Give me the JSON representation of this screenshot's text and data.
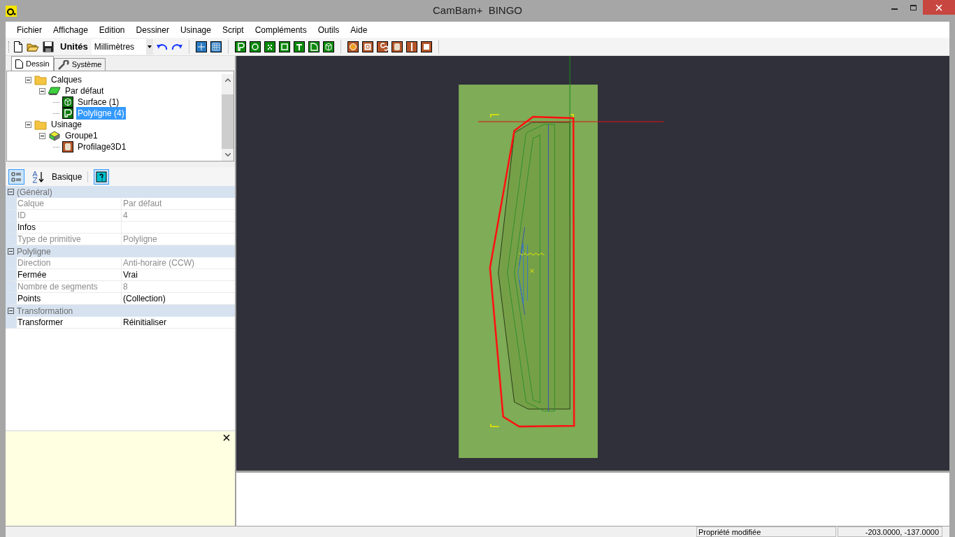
{
  "window": {
    "title": "CamBam+  BINGO"
  },
  "menu": [
    "Fichier",
    "Affichage",
    "Edition",
    "Dessiner",
    "Usinage",
    "Script",
    "Compléments",
    "Outils",
    "Aide"
  ],
  "toolbar": {
    "units_label": "Unités",
    "units_value": "Millimètres"
  },
  "tabs": [
    {
      "label": "Dessin",
      "selected": true
    },
    {
      "label": "Système",
      "selected": false
    }
  ],
  "tree": [
    {
      "label": "Calques",
      "kind": "folder",
      "expanded": true,
      "selected": false,
      "children": [
        {
          "label": "Par défaut",
          "kind": "layer",
          "expanded": true,
          "selected": false,
          "children": [
            {
              "label": "Surface (1)",
              "kind": "surface",
              "selected": false
            },
            {
              "label": "Polyligne (4)",
              "kind": "polyline",
              "selected": true
            }
          ]
        }
      ]
    },
    {
      "label": "Usinage",
      "kind": "folder",
      "expanded": true,
      "selected": false,
      "children": [
        {
          "label": "Groupe1",
          "kind": "group",
          "expanded": true,
          "selected": false,
          "children": [
            {
              "label": "Profilage3D1",
              "kind": "toolpath",
              "selected": false
            }
          ]
        }
      ]
    }
  ],
  "properties_toolbar": {
    "categorized": {
      "selected": true
    },
    "alphabetical": {
      "selected": false
    },
    "mode_label": "Basique"
  },
  "property_groups": [
    {
      "name": "(Général)",
      "expanded": true,
      "rows": [
        {
          "name": "Calque",
          "value": "Par défaut",
          "disabled": true
        },
        {
          "name": "ID",
          "value": "4",
          "disabled": true
        },
        {
          "name": "Infos",
          "disabled": false
        },
        {
          "name": "Type de primitive",
          "value": "Polyligne",
          "disabled": true
        }
      ]
    },
    {
      "name": "Polyligne",
      "expanded": true,
      "rows": [
        {
          "name": "Direction",
          "value": "Anti-horaire (CCW)",
          "disabled": true
        },
        {
          "name": "Fermée",
          "value": "Vrai",
          "disabled": false
        },
        {
          "name": "Nombre de segments",
          "value": "8",
          "disabled": true
        },
        {
          "name": "Points",
          "value": "(Collection)",
          "disabled": false
        }
      ]
    },
    {
      "name": "Transformation",
      "expanded": true,
      "rows": [
        {
          "name": "Transformer",
          "value": "Réinitialiser",
          "disabled": false
        }
      ]
    }
  ],
  "status_bar": {
    "message": "Propriété modifiée",
    "coordinates": "-203.0000, -137.0000"
  }
}
